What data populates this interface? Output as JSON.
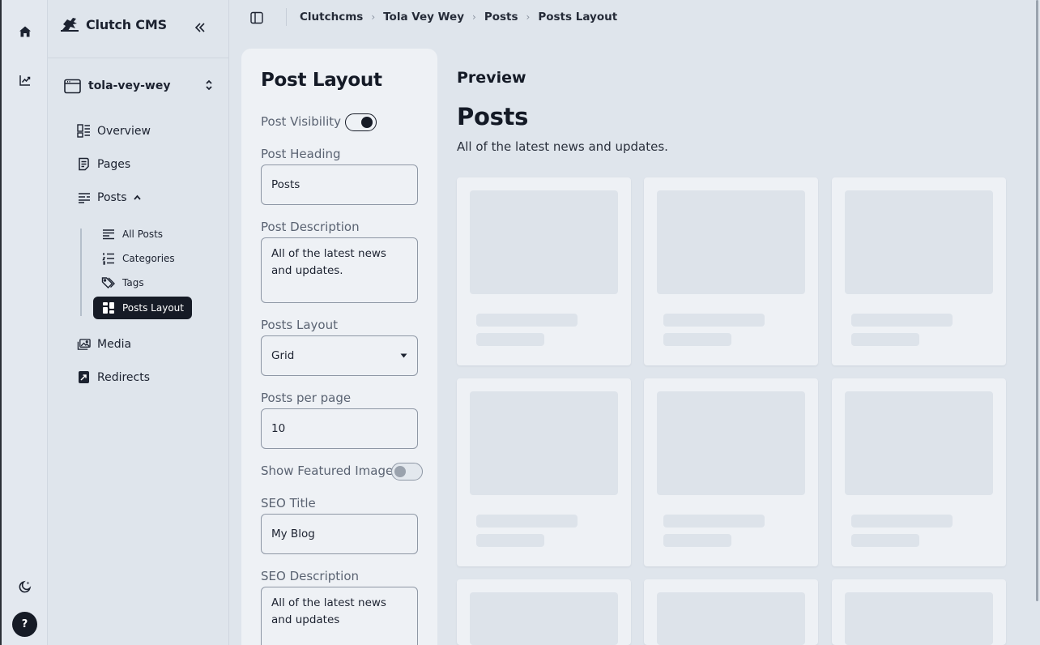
{
  "rail": {
    "home_icon": "home-icon",
    "analytics_icon": "chart-line-icon",
    "theme_icon": "moon-icon",
    "help_label": "?"
  },
  "sidebar": {
    "brand": "Clutch CMS",
    "site_name": "tola-vey-wey",
    "nav": [
      {
        "label": "Overview",
        "icon": "dashboard-icon"
      },
      {
        "label": "Pages",
        "icon": "page-icon"
      },
      {
        "label": "Posts",
        "icon": "posts-icon"
      },
      {
        "label": "Media",
        "icon": "media-icon"
      },
      {
        "label": "Redirects",
        "icon": "redirect-icon"
      }
    ],
    "posts_sub": [
      {
        "label": "All Posts",
        "icon": "list-icon"
      },
      {
        "label": "Categories",
        "icon": "numbered-list-icon"
      },
      {
        "label": "Tags",
        "icon": "tag-icon"
      },
      {
        "label": "Posts Layout",
        "icon": "layout-icon",
        "active": true
      }
    ]
  },
  "breadcrumb": [
    "Clutchcms",
    "Tola Vey Wey",
    "Posts",
    "Posts Layout"
  ],
  "form": {
    "title": "Post Layout",
    "post_visibility_label": "Post Visibility",
    "post_visibility_on": true,
    "post_heading_label": "Post Heading",
    "post_heading_value": "Posts",
    "post_description_label": "Post Description",
    "post_description_value": "All of the latest news and updates.",
    "posts_layout_label": "Posts Layout",
    "posts_layout_value": "Grid",
    "posts_per_page_label": "Posts per page",
    "posts_per_page_value": "10",
    "show_featured_label": "Show Featured Image",
    "show_featured_on": false,
    "seo_title_label": "SEO Title",
    "seo_title_value": "My Blog",
    "seo_description_label": "SEO Description",
    "seo_description_value": "All of the latest news and updates"
  },
  "preview": {
    "label": "Preview",
    "title": "Posts",
    "description": "All of the latest news and updates."
  },
  "colors": {
    "accent_dark": "#161b26",
    "background": "#dfe5ec",
    "panel": "#eef1f5",
    "skeleton": "#dde3ea"
  }
}
